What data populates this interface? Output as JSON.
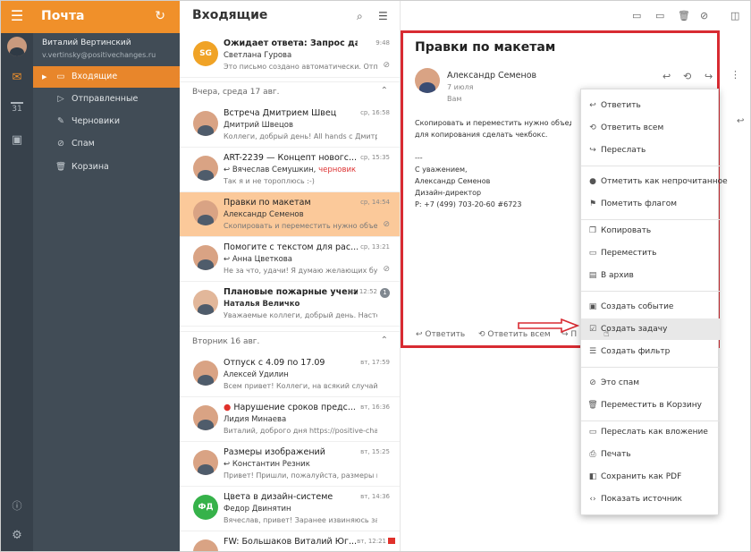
{
  "sidebar": {
    "app_title": "Почта",
    "user_name": "Виталий Вертинский",
    "user_email": "v.vertinsky@positivechanges.ru",
    "folders": [
      {
        "label": "Входящие"
      },
      {
        "label": "Отправленные"
      },
      {
        "label": "Черновики"
      },
      {
        "label": "Спам"
      },
      {
        "label": "Корзина"
      }
    ]
  },
  "rail": {
    "calendar_day": "31"
  },
  "list": {
    "title": "Входящие",
    "groups": [
      {
        "label": "Вчера, среда 17 авг."
      },
      {
        "label": "Вторник 16 авг."
      }
    ],
    "messages": [
      {
        "subject": "Ожидает ответа: Запрос данных",
        "from": "Светлана Гурова",
        "snippet": "Это письмо создано автоматически. Отпр ...",
        "date": "9:48",
        "initials": "SG"
      },
      {
        "subject": "Встреча Дмитрием Швец",
        "from": "Дмитрий Швецов",
        "snippet": "Коллеги, добрый день! All hands с Дмитрием Ш...",
        "date": "ср, 16:58"
      },
      {
        "subject": "ART-2239 — Концепт новогс...",
        "from": "Вячеслав Семушкин,",
        "from_extra": "черновик",
        "snippet": "Так я и не тороплюсь :-)",
        "date": "ср, 15:35"
      },
      {
        "subject": "Правки по макетам",
        "from": "Александр Семенов",
        "snippet": "Скопировать и переместить нужно объеди...",
        "date": "ср, 14:54"
      },
      {
        "subject": "Помогите с текстом для рас...",
        "from": "Анна Цветкова",
        "snippet": "Не за что, удачи! Я думаю желающих буде...",
        "date": "ср, 13:21"
      },
      {
        "subject": "Плановые пожарные учени",
        "from": "Наталья Величко",
        "snippet": "Уважаемые коллеги, добрый день. Настоящим ...",
        "date": "ср, 12:52",
        "badge": "1"
      },
      {
        "subject": "Отпуск с 4.09 по 17.09",
        "from": "Алексей Удилин",
        "snippet": "Всем привет! Коллеги, на всякий случай напом...",
        "date": "вт, 17:59"
      },
      {
        "subject": "Нарушение сроков предс...",
        "from": "Лидия Минаева",
        "snippet": "Виталий, доброго дня https://positive-changes....",
        "date": "вт, 16:36"
      },
      {
        "subject": "Размеры изображений",
        "from": "Константин Резник",
        "snippet": "Привет! Пришли, пожалуйста, размеры изобр...",
        "date": "вт, 15:25"
      },
      {
        "subject": "Цвета в дизайн-системе",
        "from": "Федор Двинятин",
        "snippet": "Вячеслав, привет! Заранее извиняюсь за навя...",
        "date": "вт, 14:36",
        "initials": "ФД"
      },
      {
        "subject": "FW: Большаков Виталий Юг...",
        "from": "",
        "snippet": "",
        "date": "вт, 12:21"
      }
    ]
  },
  "message": {
    "title": "Правки по макетам",
    "sender": "Александр Семенов",
    "date": "7 июля",
    "to": "Вам",
    "body_lines": [
      "Скопировать и переместить нужно объединить в",
      "для копирования сделать чекбокс.",
      "",
      "---",
      "С уважением,",
      "Александр Семенов",
      "Дизайн-директор",
      "Р: +7 (499) 703-20-60 #6723"
    ],
    "reply_label": "Ответить",
    "reply_all_label": "Ответить всем",
    "forward_label": "П"
  },
  "menu": {
    "items": [
      {
        "label": "Ответить"
      },
      {
        "label": "Ответить всем"
      },
      {
        "label": "Переслать"
      },
      {
        "label": "Отметить как непрочитанное"
      },
      {
        "label": "Пометить флагом"
      },
      {
        "label": "Копировать"
      },
      {
        "label": "Переместить"
      },
      {
        "label": "В архив"
      },
      {
        "label": "Создать событие"
      },
      {
        "label": "Создать задачу"
      },
      {
        "label": "Создать фильтр"
      },
      {
        "label": "Это спам"
      },
      {
        "label": "Переместить в Корзину"
      },
      {
        "label": "Переслать как вложение"
      },
      {
        "label": "Печать"
      },
      {
        "label": "Сохранить как PDF"
      },
      {
        "label": "Показать источник"
      }
    ]
  },
  "colors": {
    "accent": "#f0902a",
    "sidebar": "#414c56",
    "rail": "#37414b",
    "selected": "#fbc99a",
    "highlight_frame": "#d82b32"
  }
}
